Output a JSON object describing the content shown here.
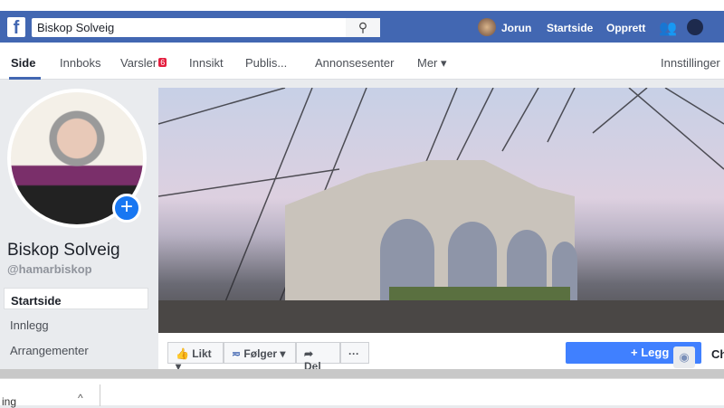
{
  "header": {
    "logo": "f",
    "search_value": "Biskop Solveig",
    "search_icon": "search-icon",
    "user": "Jorun",
    "home": "Startside",
    "create": "Opprett",
    "icons": [
      "friends-icon",
      "messenger-icon"
    ]
  },
  "nav": {
    "tabs": [
      {
        "label": "Side"
      },
      {
        "label": "Innboks"
      },
      {
        "label": "Varsler",
        "badge": "6"
      },
      {
        "label": "Innsikt"
      },
      {
        "label": "Publis..."
      },
      {
        "label": "Annonsesenter"
      },
      {
        "label": "Mer ▾"
      }
    ],
    "settings": "Innstillinger"
  },
  "profile": {
    "name": "Biskop Solveig",
    "handle": "@hamarbiskop"
  },
  "sidebar": {
    "items": [
      {
        "label": "Startside"
      },
      {
        "label": "Innlegg"
      },
      {
        "label": "Arrangementer"
      }
    ]
  },
  "actions": {
    "like": "Likt ▾",
    "follow": "Følger ▾",
    "share": "Del",
    "more": "···",
    "add": "+ Legg",
    "ch": "Ch"
  },
  "download": {
    "file": "ing",
    "chevron": "^"
  },
  "colors": {
    "brand": "#4267b2",
    "primary": "#4080ff",
    "badge": "#e41e3f"
  }
}
